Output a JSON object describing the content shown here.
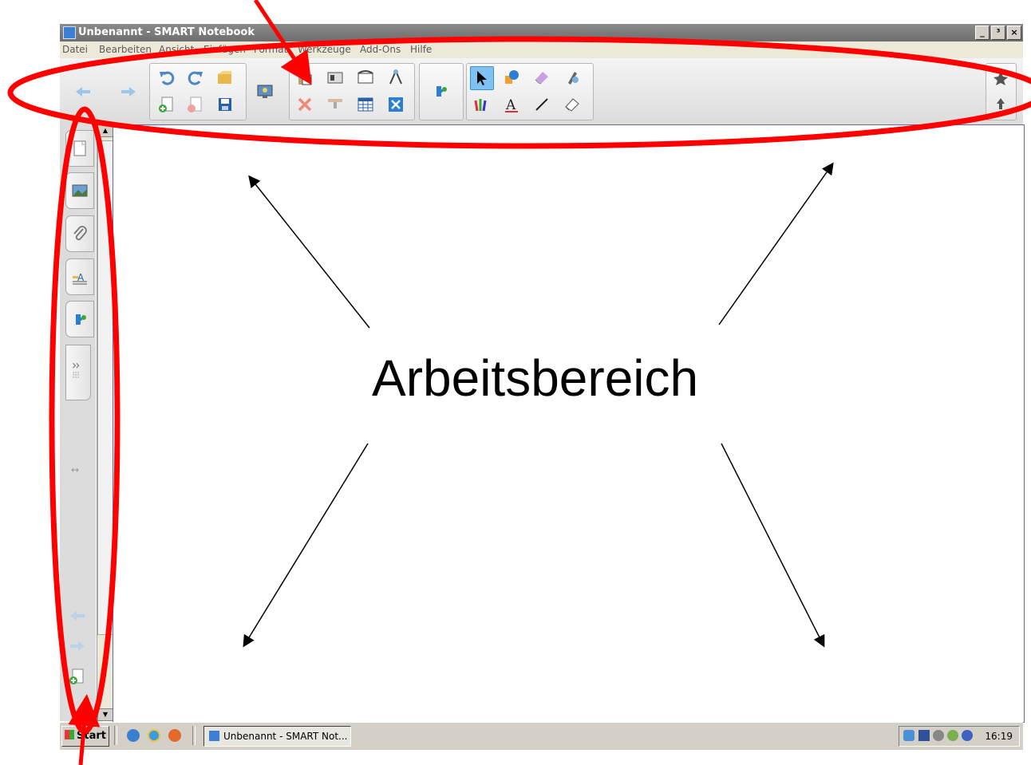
{
  "window": {
    "title": "Unbenannt - SMART Notebook",
    "controls": [
      "_",
      "³",
      "×"
    ]
  },
  "menu": [
    "Datei",
    "Bearbeiten",
    "Ansicht",
    "Einfügen",
    "Format",
    "Werkzeuge",
    "Add-Ons",
    "Hilfe"
  ],
  "toolbar": {
    "icons": [
      "back-arrow-icon",
      "forward-arrow-icon",
      "undo-icon",
      "redo-icon",
      "open-folder-icon",
      "new-page-icon",
      "delete-page-icon",
      "save-icon",
      "display-icon",
      "paste-icon",
      "camera-icon",
      "screen-shade-icon",
      "measurement-tools-icon",
      "delete-icon",
      "screen-toggle-icon",
      "table-icon",
      "full-screen-icon",
      "add-ons-icon",
      "select-icon",
      "shapes-icon",
      "eraser-icon",
      "magic-pen-icon",
      "pens-icon",
      "text-icon",
      "line-icon",
      "eraser-tool-icon",
      "pin-icon",
      "move-toolbar-icon"
    ]
  },
  "sidebar": {
    "tabs": [
      "page-sorter-icon",
      "gallery-icon",
      "attachments-icon",
      "properties-icon",
      "add-ons-icon"
    ]
  },
  "canvas": {
    "label": "Arbeitsbereich"
  },
  "taskbar": {
    "start_label": "Start",
    "task_label": "Unbenannt - SMART Not...",
    "clock": "16:19"
  },
  "colors": {
    "annotation": "#ff0000",
    "active_tool": "#7fc1f5"
  }
}
